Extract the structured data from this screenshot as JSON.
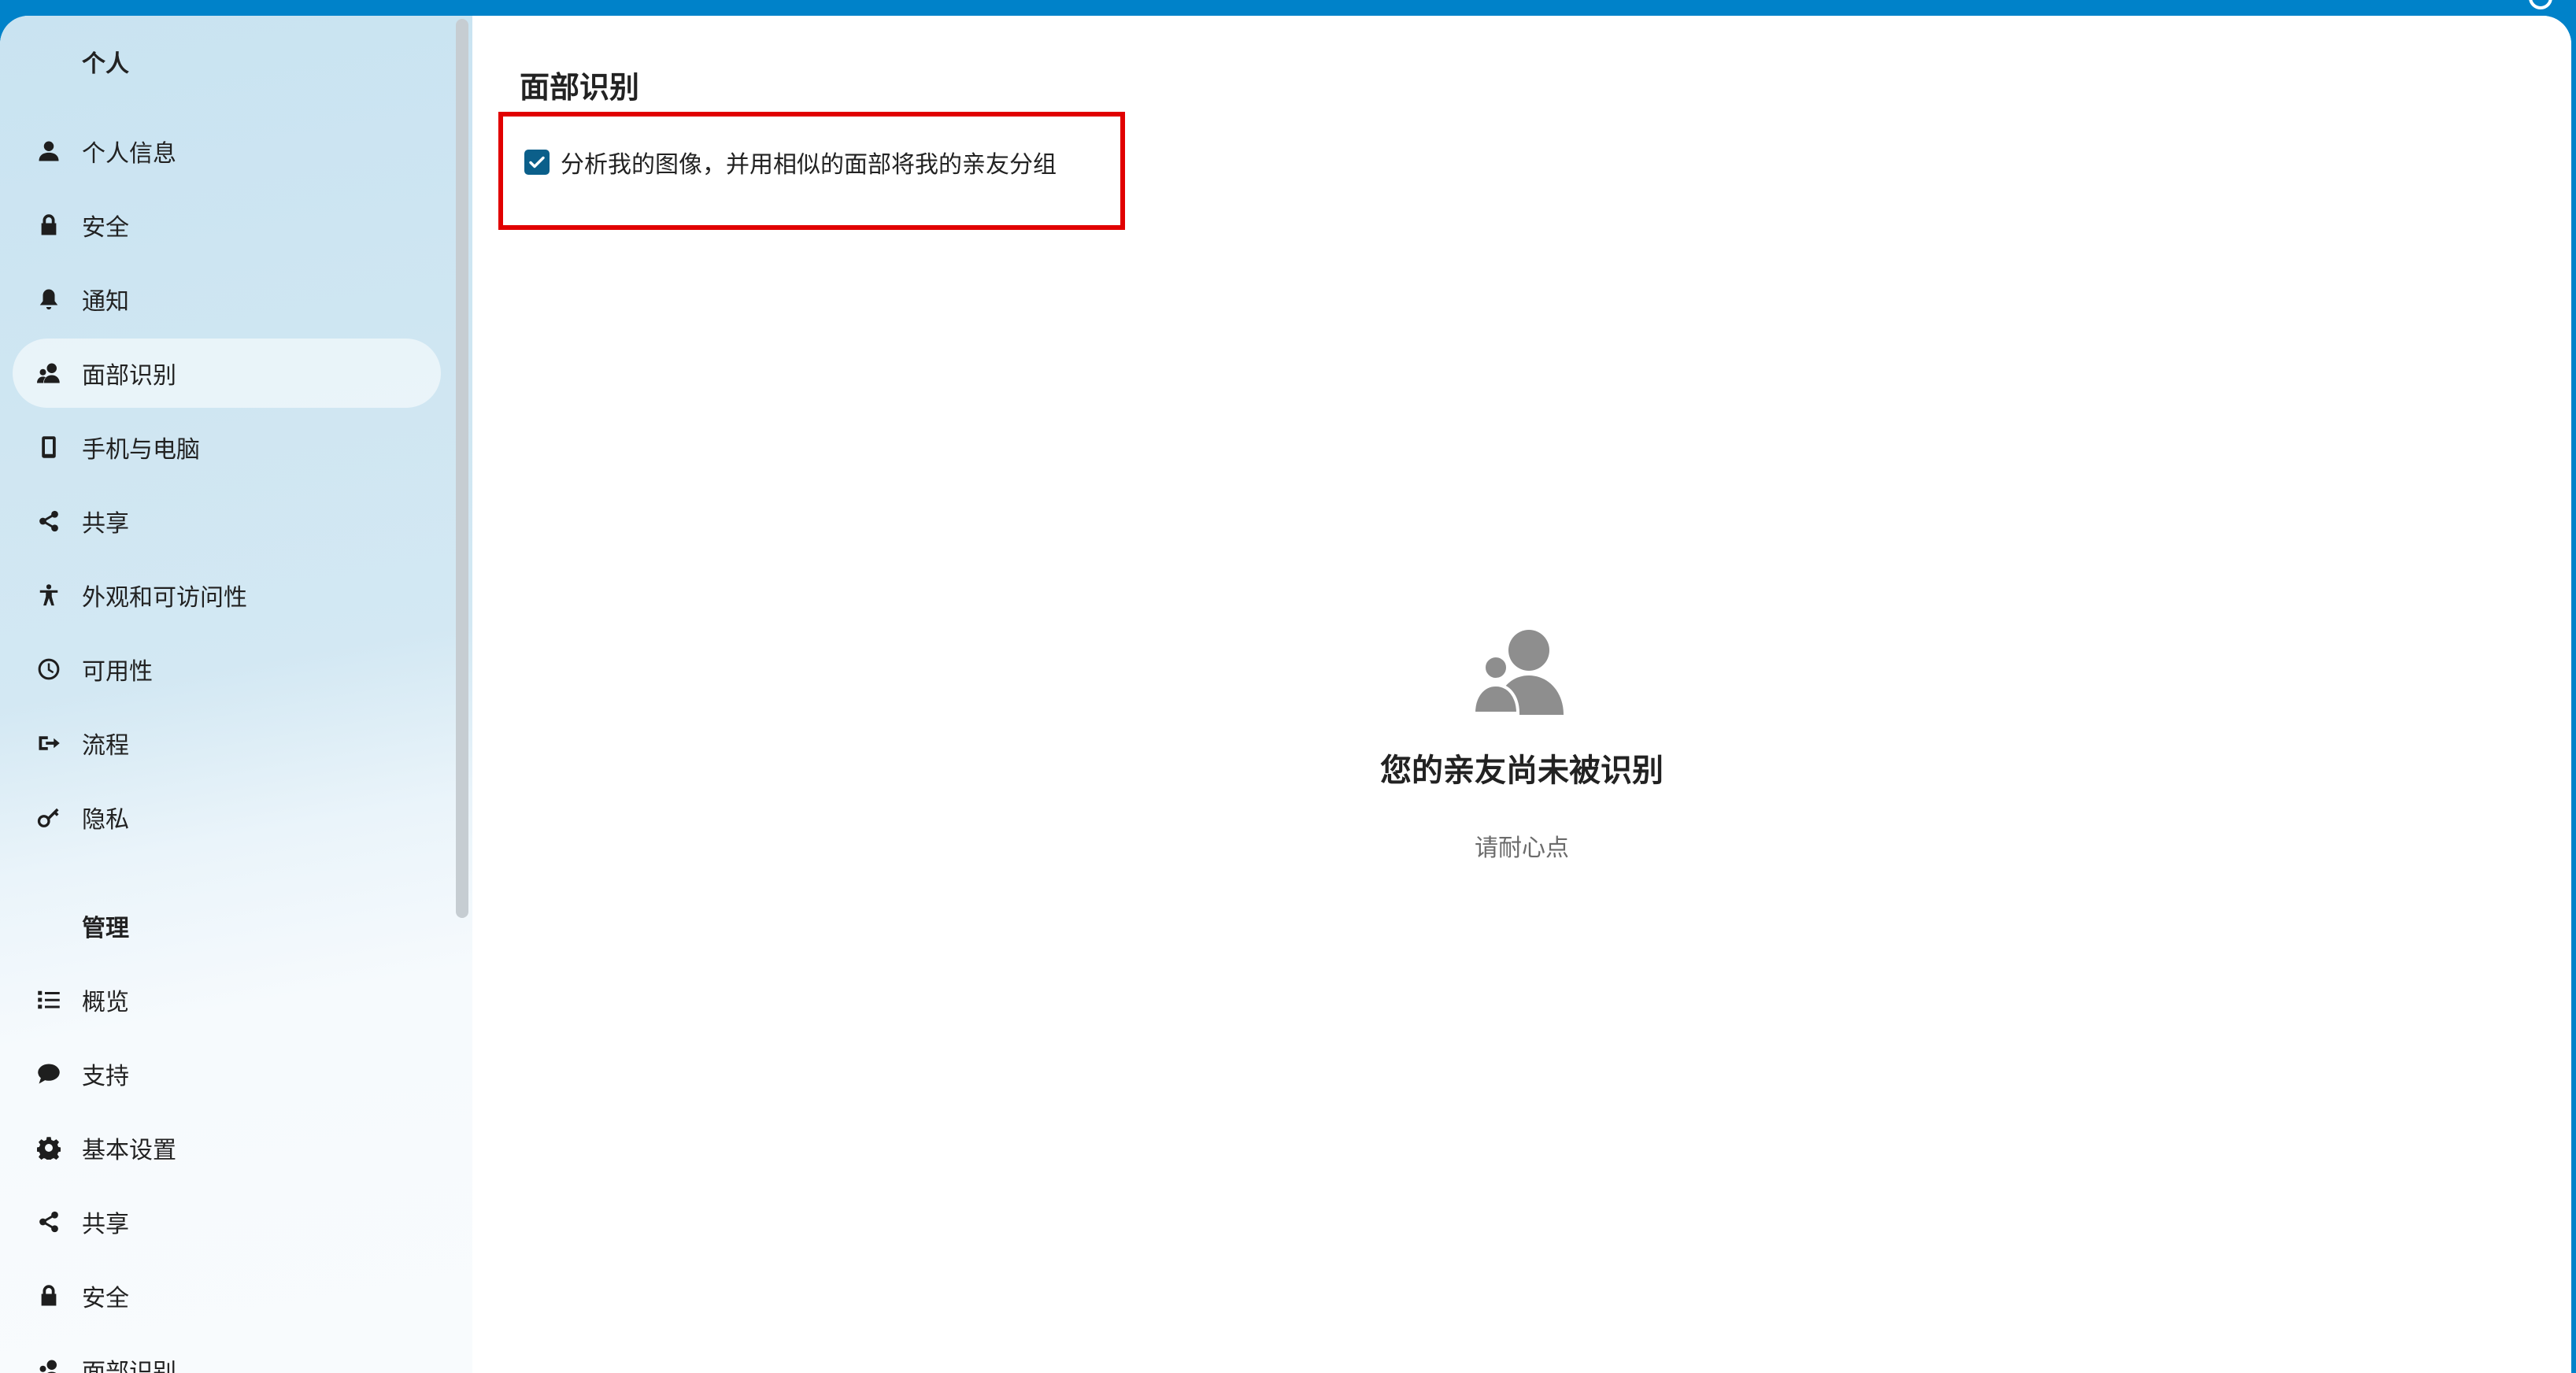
{
  "colors": {
    "topbar": "#0082c9",
    "checkbox": "#0b5f8a",
    "highlight": "#e10000"
  },
  "sidebar": {
    "personal_caption": "个人",
    "personal_items": [
      {
        "label": "个人信息",
        "icon": "user-icon"
      },
      {
        "label": "安全",
        "icon": "lock-icon"
      },
      {
        "label": "通知",
        "icon": "bell-icon"
      },
      {
        "label": "面部识别",
        "icon": "people-icon",
        "active": true
      },
      {
        "label": "手机与电脑",
        "icon": "phone-icon"
      },
      {
        "label": "共享",
        "icon": "share-icon"
      },
      {
        "label": "外观和可访问性",
        "icon": "accessibility-icon"
      },
      {
        "label": "可用性",
        "icon": "clock-icon"
      },
      {
        "label": "流程",
        "icon": "flow-icon"
      },
      {
        "label": "隐私",
        "icon": "key-icon"
      }
    ],
    "admin_caption": "管理",
    "admin_items": [
      {
        "label": "概览",
        "icon": "list-icon"
      },
      {
        "label": "支持",
        "icon": "chat-icon"
      },
      {
        "label": "基本设置",
        "icon": "gear-icon"
      },
      {
        "label": "共享",
        "icon": "share-icon"
      },
      {
        "label": "安全",
        "icon": "lock-icon"
      },
      {
        "label": "面部识别",
        "icon": "people-icon"
      }
    ]
  },
  "main": {
    "title": "面部识别",
    "checkbox": {
      "label": "分析我的图像，并用相似的面部将我的亲友分组",
      "checked": true
    },
    "empty_state": {
      "icon": "people-icon",
      "title": "您的亲友尚未被识别",
      "subtitle": "请耐心点"
    }
  }
}
